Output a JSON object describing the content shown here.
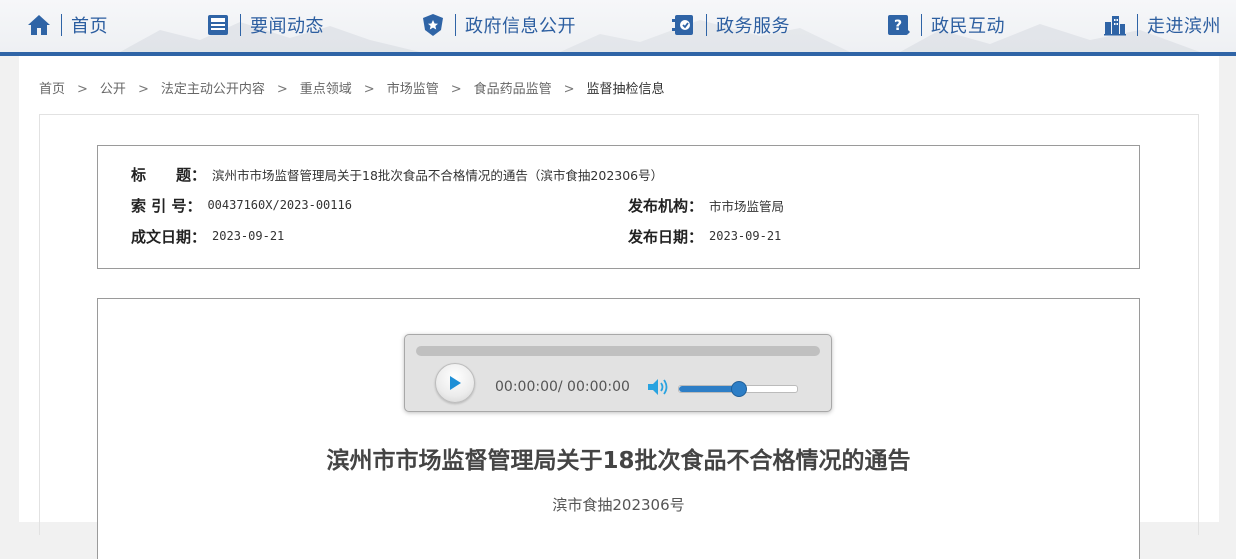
{
  "nav": {
    "items": [
      {
        "label": "首页",
        "icon": "home-icon"
      },
      {
        "label": "要闻动态",
        "icon": "news-icon"
      },
      {
        "label": "政府信息公开",
        "icon": "badge-icon"
      },
      {
        "label": "政务服务",
        "icon": "service-icon"
      },
      {
        "label": "政民互动",
        "icon": "question-icon"
      },
      {
        "label": "走进滨州",
        "icon": "building-icon"
      }
    ]
  },
  "breadcrumb": {
    "items": [
      "首页",
      "公开",
      "法定主动公开内容",
      "重点领域",
      "市场监管",
      "食品药品监管"
    ],
    "current": "监督抽检信息",
    "separator": ">"
  },
  "meta": {
    "title_key": "标　　题：",
    "title_value": "滨州市市场监督管理局关于18批次食品不合格情况的通告（滨市食抽202306号）",
    "index_key": "索 引 号：",
    "index_value": "00437160X/2023-00116",
    "publisher_key": "发布机构：",
    "publisher_value": "市市场监管局",
    "created_key": "成文日期：",
    "created_value": "2023-09-21",
    "published_key": "发布日期：",
    "published_value": "2023-09-21"
  },
  "player": {
    "time": "00:00:00/ 00:00:00",
    "volume": 0.5,
    "progress": 0,
    "accent": "#2d7ec6"
  },
  "document": {
    "title": "滨州市市场监督管理局关于18批次食品不合格情况的通告",
    "number": "滨市食抽202306号"
  },
  "colors": {
    "brand_blue": "#2f64a6",
    "nav_text": "#2c5ea0"
  }
}
